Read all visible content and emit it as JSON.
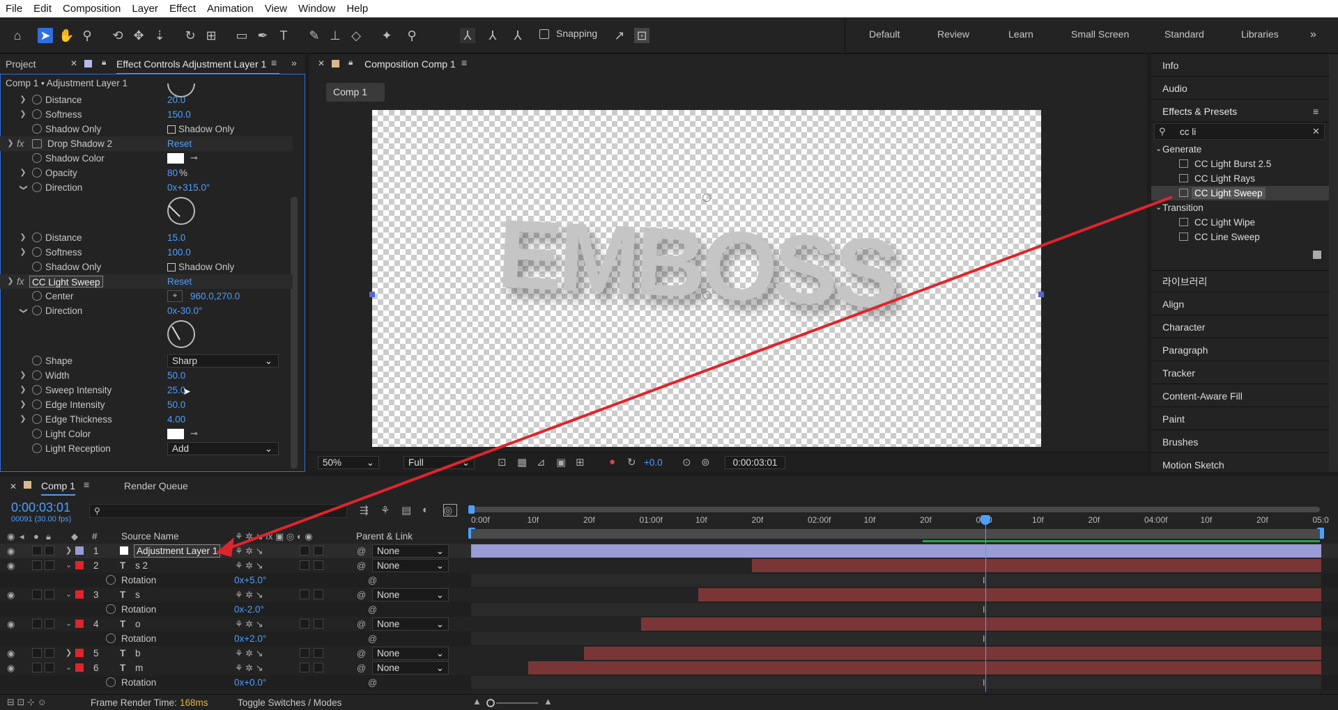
{
  "menu": [
    "File",
    "Edit",
    "Composition",
    "Layer",
    "Effect",
    "Animation",
    "View",
    "Window",
    "Help"
  ],
  "toolbar": {
    "snapping": "Snapping",
    "workspaces": [
      "Default",
      "Review",
      "Learn",
      "Small Screen",
      "Standard",
      "Libraries"
    ]
  },
  "left": {
    "tab_project": "Project",
    "tab_effect": "Effect Controls Adjustment Layer 1",
    "breadcrumb": "Comp 1 • Adjustment Layer 1",
    "p": {
      "dist1": "Distance",
      "dist1v": "20.0",
      "soft1": "Softness",
      "soft1v": "150.0",
      "so1": "Shadow Only",
      "so1v": "Shadow Only",
      "ds2": "Drop Shadow 2",
      "ds2r": "Reset",
      "sc": "Shadow Color",
      "op": "Opacity",
      "opv": "80",
      "pct": "%",
      "dir": "Direction",
      "dirv": "0x+315.0°",
      "dist2": "Distance",
      "dist2v": "15.0",
      "soft2": "Softness",
      "soft2v": "100.0",
      "so2": "Shadow Only",
      "so2v": "Shadow Only",
      "cls": "CC Light Sweep",
      "clsr": "Reset",
      "center": "Center",
      "centerv": "960.0,270.0",
      "dir2": "Direction",
      "dir2v": "0x-30.0°",
      "shape": "Shape",
      "shapev": "Sharp",
      "width": "Width",
      "widthv": "50.0",
      "si": "Sweep Intensity",
      "siv": "25.0",
      "ei": "Edge Intensity",
      "eiv": "50.0",
      "et": "Edge Thickness",
      "etv": "4.00",
      "lc": "Light Color",
      "lr": "Light Reception",
      "lrv": "Add"
    }
  },
  "comp": {
    "tab": "Composition Comp 1",
    "subtab": "Comp 1",
    "canvas_text": "EMBOSS",
    "zoom": "50%",
    "res": "Full",
    "exposure": "+0.0",
    "time": "0:00:03:01"
  },
  "right": {
    "items": [
      "Info",
      "Audio"
    ],
    "ep_title": "Effects & Presets",
    "search": "cc li",
    "gen": "Generate",
    "gen_items": [
      "CC Light Burst 2.5",
      "CC Light Rays",
      "CC Light Sweep"
    ],
    "trans": "Transition",
    "trans_items": [
      "CC Light Wipe",
      "CC Line Sweep"
    ],
    "more": [
      "라이브러리",
      "Align",
      "Character",
      "Paragraph",
      "Tracker",
      "Content-Aware Fill",
      "Paint",
      "Brushes",
      "Motion Sketch"
    ]
  },
  "timeline": {
    "tab": "Comp 1",
    "rq": "Render Queue",
    "time": "0:00:03:01",
    "frames": "00091 (30.00 fps)",
    "col_num": "#",
    "col_src": "Source Name",
    "col_parent": "Parent & Link",
    "ruler": [
      "0:00f",
      "10f",
      "20f",
      "01:00f",
      "10f",
      "20f",
      "02:00f",
      "10f",
      "20f",
      "03:0",
      "10f",
      "20f",
      "04:00f",
      "10f",
      "20f",
      "05:0"
    ],
    "layers": [
      {
        "n": "1",
        "name": "Adjustment Layer 1",
        "parent": "None",
        "start": 0.0,
        "color": "#9a9cd6"
      },
      {
        "n": "2",
        "name": "s 2",
        "parent": "None",
        "start": 0.33
      },
      {
        "n": "3",
        "name": "s",
        "parent": "None",
        "start": 0.267
      },
      {
        "n": "4",
        "name": "o",
        "parent": "None",
        "start": 0.2
      },
      {
        "n": "5",
        "name": "b",
        "parent": "None",
        "start": 0.133
      },
      {
        "n": "6",
        "name": "m",
        "parent": "None",
        "start": 0.067
      }
    ],
    "rot": {
      "label": "Rotation",
      "r2": "0x+5.0°",
      "r3": "0x-2.0°",
      "r4": "0x+2.0°",
      "r6": "0x+0.0°"
    },
    "footer": {
      "frt": "Frame Render Time:",
      "frtv": "168ms",
      "toggle": "Toggle Switches / Modes"
    }
  },
  "colors": {
    "accent": "#4d9fff",
    "red": "#e0242c",
    "layer_red": "#7a3636"
  }
}
